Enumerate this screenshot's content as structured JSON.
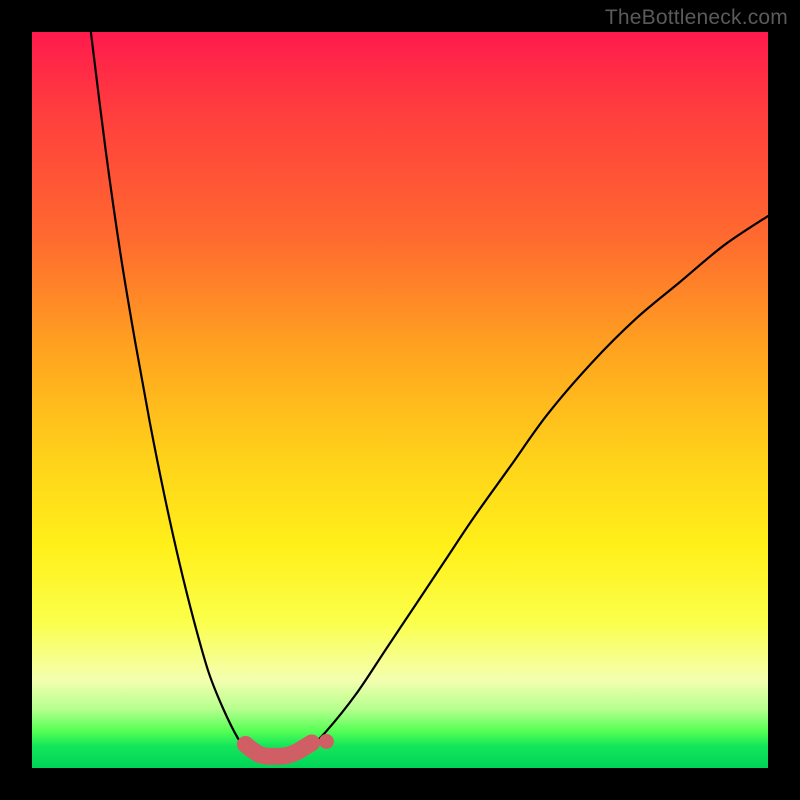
{
  "watermark": "TheBottleneck.com",
  "chart_data": {
    "type": "line",
    "title": "",
    "xlabel": "",
    "ylabel": "",
    "xlim": [
      0,
      100
    ],
    "ylim": [
      0,
      100
    ],
    "series": [
      {
        "name": "curve-left",
        "x": [
          8,
          10,
          12,
          14,
          16,
          18,
          20,
          22,
          24,
          26,
          28,
          29.5
        ],
        "values": [
          100,
          84,
          70,
          58,
          47,
          37,
          28,
          20,
          13,
          8,
          4,
          2
        ]
      },
      {
        "name": "curve-right",
        "x": [
          37,
          40,
          44,
          48,
          52,
          56,
          60,
          65,
          70,
          76,
          82,
          88,
          94,
          100
        ],
        "values": [
          2,
          5,
          10,
          16,
          22,
          28,
          34,
          41,
          48,
          55,
          61,
          66,
          71,
          75
        ]
      },
      {
        "name": "trough-band",
        "x": [
          29,
          30,
          31,
          32,
          33,
          34,
          35,
          36,
          37,
          38
        ],
        "values": [
          3.2,
          2.4,
          1.8,
          1.6,
          1.6,
          1.6,
          1.8,
          2.2,
          2.8,
          3.4
        ]
      },
      {
        "name": "trough-dot",
        "x": [
          40
        ],
        "values": [
          3.6
        ]
      }
    ],
    "colors": {
      "curve": "#000000",
      "trough": "#cf5f64"
    }
  }
}
